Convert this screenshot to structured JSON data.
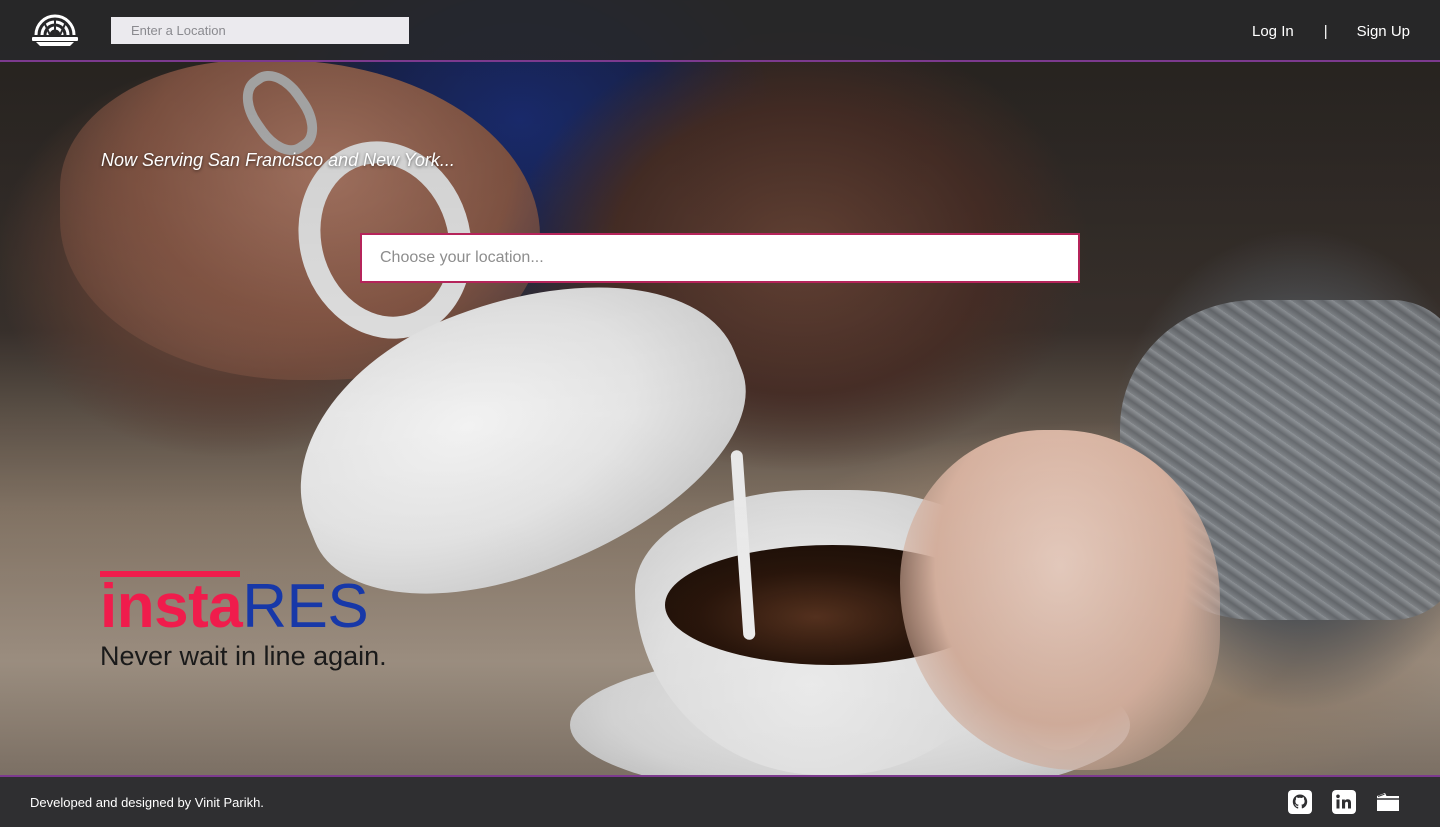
{
  "header": {
    "search_placeholder": "Enter a Location",
    "nav": {
      "login": "Log In",
      "separator": "|",
      "signup": "Sign Up"
    }
  },
  "hero": {
    "tagline": "Now Serving San Francisco and New York...",
    "search_placeholder": "Choose your location...",
    "brand": {
      "name_part1": "insta",
      "name_part2": "RES",
      "slogan": "Never wait in line again."
    }
  },
  "footer": {
    "credit": "Developed and designed by Vinit Parikh.",
    "social_icons": [
      "github-icon",
      "linkedin-icon",
      "portfolio-folder-icon"
    ]
  },
  "colors": {
    "accent_pink": "#f01c4c",
    "accent_blue": "#1738a8",
    "border_purple": "#7c3a8e",
    "bar_dark": "#2f2f31"
  }
}
